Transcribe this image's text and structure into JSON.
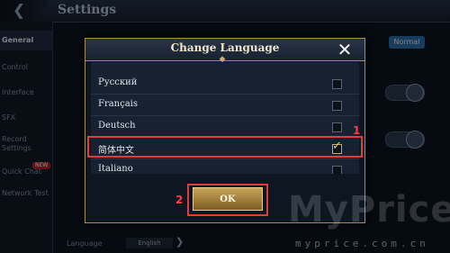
{
  "header": {
    "title": "Settings",
    "back_icon": "back-arrow-icon"
  },
  "sidebar": {
    "items": [
      {
        "label": "General"
      },
      {
        "label": "Control"
      },
      {
        "label": "Interface"
      },
      {
        "label": "SFX"
      },
      {
        "label": "Record Settings"
      },
      {
        "label": "Quick Chat",
        "badge": "NEW"
      },
      {
        "label": "Network Test"
      }
    ]
  },
  "background": {
    "quality_button": "Normal",
    "language_label": "Language",
    "language_value": "English"
  },
  "modal": {
    "title": "Change Language",
    "languages": [
      {
        "name": "Русский",
        "selected": false
      },
      {
        "name": "Français",
        "selected": false
      },
      {
        "name": "Deutsch",
        "selected": false
      },
      {
        "name": "简体中文",
        "selected": true
      },
      {
        "name": "Italiano",
        "selected": false
      }
    ],
    "ok_label": "OK"
  },
  "annotations": {
    "marker_1": "1",
    "marker_2": "2"
  },
  "watermark": {
    "text": "MyPrice",
    "sub": "myprice.com.cn"
  },
  "colors": {
    "accent_gold": "#c9a86a",
    "highlight_red": "#e23b3b"
  }
}
